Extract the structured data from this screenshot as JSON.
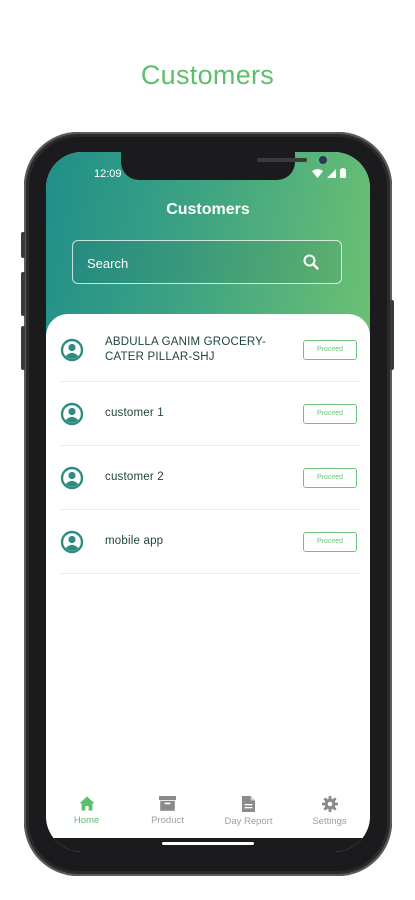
{
  "page": {
    "title": "Customers"
  },
  "status_bar": {
    "time": "12:09"
  },
  "header": {
    "title": "Customers"
  },
  "search": {
    "placeholder": "Search"
  },
  "customers": [
    {
      "name": "ABDULLA GANIM GROCERY-CATER PILLAR-SHJ",
      "action": "Proceed"
    },
    {
      "name": "customer 1",
      "action": "Proceed"
    },
    {
      "name": "customer 2",
      "action": "Proceed"
    },
    {
      "name": "mobile app",
      "action": "Proceed"
    }
  ],
  "nav": {
    "items": [
      {
        "label": "Home",
        "icon": "home-icon",
        "active": true
      },
      {
        "label": "Product",
        "icon": "archive-box-icon",
        "active": false
      },
      {
        "label": "Day Report",
        "icon": "document-icon",
        "active": false
      },
      {
        "label": "Settings",
        "icon": "gear-icon",
        "active": false
      }
    ]
  },
  "colors": {
    "accent_green": "#5cbf6b",
    "header_gradient_start": "#1f8f8a",
    "header_gradient_end": "#6cc172",
    "avatar_teal": "#2f8c80",
    "text_dark": "#1f4340"
  }
}
